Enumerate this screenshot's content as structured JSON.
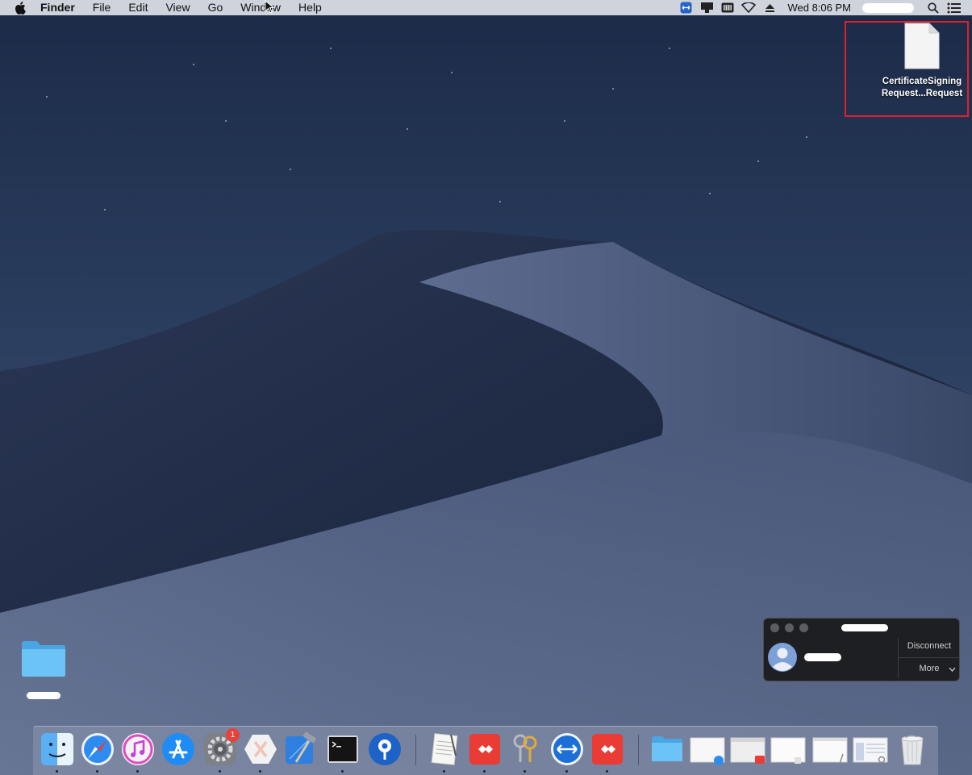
{
  "menubar": {
    "app_name": "Finder",
    "items": [
      "File",
      "Edit",
      "View",
      "Go",
      "Window",
      "Help"
    ],
    "clock": "Wed 8:06 PM"
  },
  "desktop": {
    "file_icon": {
      "label_line1": "CertificateSigning",
      "label_line2": "Request...Request"
    }
  },
  "remote_panel": {
    "disconnect_label": "Disconnect",
    "more_label": "More"
  },
  "dock": {
    "system_preferences_badge": "1"
  },
  "colors": {
    "highlight_border": "#e0202c",
    "menubar_bg": "#cfd3db",
    "folder_blue": "#5ab8f0"
  }
}
